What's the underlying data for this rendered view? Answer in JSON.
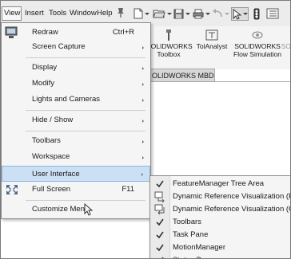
{
  "menubar": {
    "items": [
      "View",
      "Insert",
      "Tools",
      "Window",
      "Help"
    ]
  },
  "ribbon": {
    "buttons": [
      {
        "line1": "SOLIDWORKS",
        "line2": "Toolbox"
      },
      {
        "line1": "TolAnalyst",
        "line2": ""
      },
      {
        "line1": "SOLIDWORKS",
        "line2": "Flow Simulation"
      },
      {
        "line1": "SOI",
        "line2": ""
      }
    ],
    "tab": "OLIDWORKS MBD"
  },
  "view_menu": {
    "items": [
      {
        "label": "Redraw",
        "shortcut": "Ctrl+R",
        "icon": "redraw-icon"
      },
      {
        "label": "Screen Capture",
        "submenu": true
      },
      {
        "label": "Display",
        "submenu": true
      },
      {
        "label": "Modify",
        "submenu": true
      },
      {
        "label": "Lights and Cameras",
        "submenu": true
      },
      {
        "label": "Hide / Show",
        "submenu": true
      },
      {
        "label": "Toolbars",
        "submenu": true
      },
      {
        "label": "Workspace",
        "submenu": true
      },
      {
        "label": "User Interface",
        "submenu": true,
        "highlighted": true
      },
      {
        "label": "Full Screen",
        "shortcut": "F11",
        "icon": "full-screen-icon"
      },
      {
        "label": "Customize Menu"
      }
    ]
  },
  "ui_submenu": {
    "items": [
      {
        "label": "FeatureManager Tree Area",
        "checked": true
      },
      {
        "label": "Dynamic Reference Visualization (Parent)",
        "icon": "dynamic-ref-parent-icon"
      },
      {
        "label": "Dynamic Reference Visualization (Child)",
        "icon": "dynamic-ref-child-icon"
      },
      {
        "label": "Toolbars",
        "checked": true
      },
      {
        "label": "Task Pane",
        "checked": true
      },
      {
        "label": "MotionManager",
        "checked": true
      },
      {
        "label": "Status Bar",
        "checked": true
      }
    ]
  }
}
